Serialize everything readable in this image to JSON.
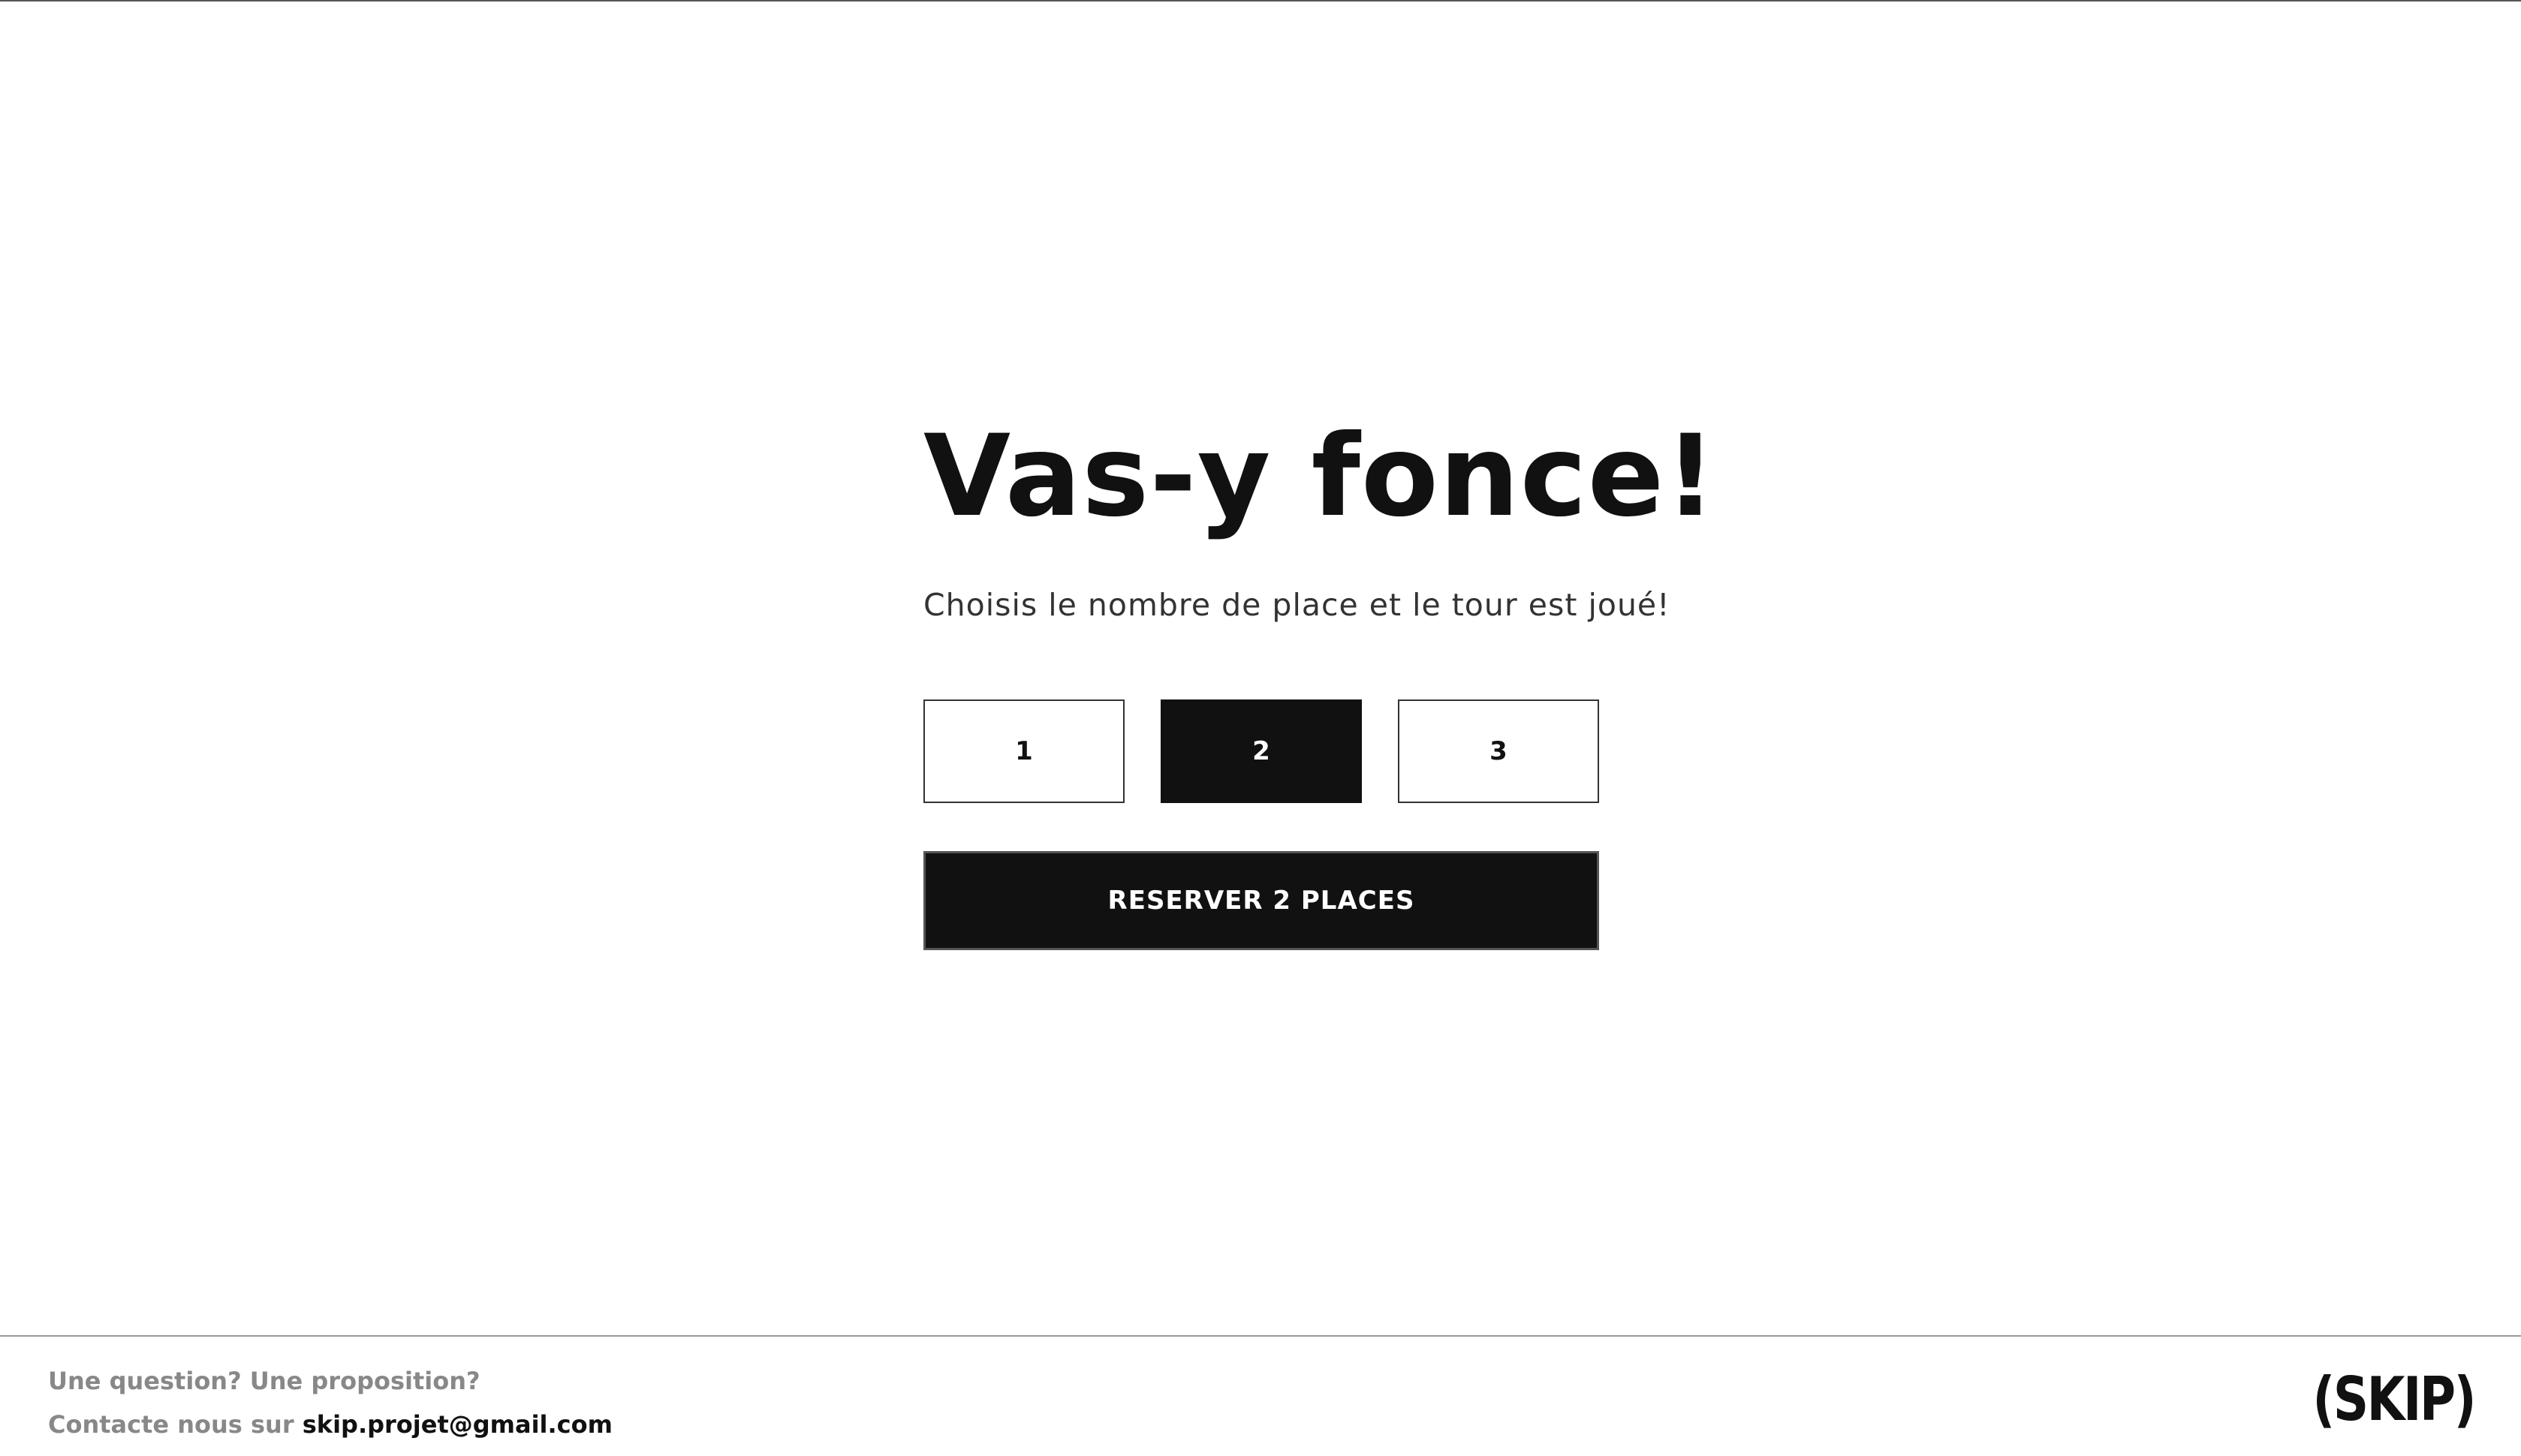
{
  "main": {
    "headline": "Vas-y fonce!",
    "subtitle": "Choisis le nombre de place et le tour est joué!",
    "seat_options": [
      {
        "label": "1",
        "selected": false
      },
      {
        "label": "2",
        "selected": true
      },
      {
        "label": "3",
        "selected": false
      }
    ],
    "reserve_button_label": "RESERVER 2 PLACES"
  },
  "footer": {
    "question_text": "Une question? Une proposition?",
    "contact_prefix": "Contacte nous sur",
    "email": "skip.projet@gmail.com",
    "brand": "(SKIP)"
  },
  "colors": {
    "primary": "#111111",
    "background": "#ffffff",
    "muted_text": "#888888"
  }
}
